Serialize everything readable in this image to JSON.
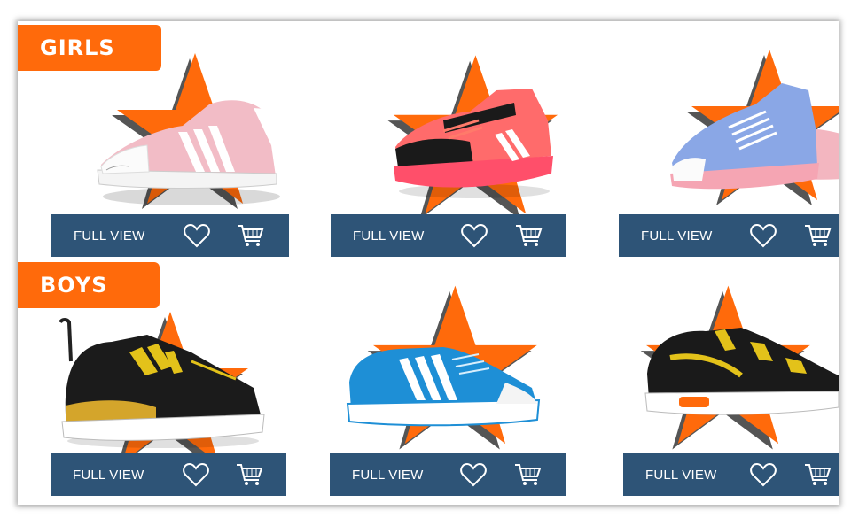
{
  "sections": {
    "girls": {
      "label": "GIRLS"
    },
    "boys": {
      "label": "BOYS"
    }
  },
  "actions": {
    "full_view": "FULL VIEW",
    "wishlist_icon": "heart-icon",
    "cart_icon": "cart-icon"
  },
  "colors": {
    "accent": "#ff6a0b",
    "bar": "#2e5477",
    "star_shadow": "#555555"
  },
  "products": [
    {
      "section": "GIRLS",
      "shoe": "pink trainer with white stripes"
    },
    {
      "section": "GIRLS",
      "shoe": "coral and black strap runner"
    },
    {
      "section": "GIRLS",
      "shoe": "light blue lace-up canvas"
    },
    {
      "section": "BOYS",
      "shoe": "black and gold bee trainer"
    },
    {
      "section": "BOYS",
      "shoe": "blue canvas with white stripes"
    },
    {
      "section": "BOYS",
      "shoe": "black air trainer with bee print"
    }
  ]
}
